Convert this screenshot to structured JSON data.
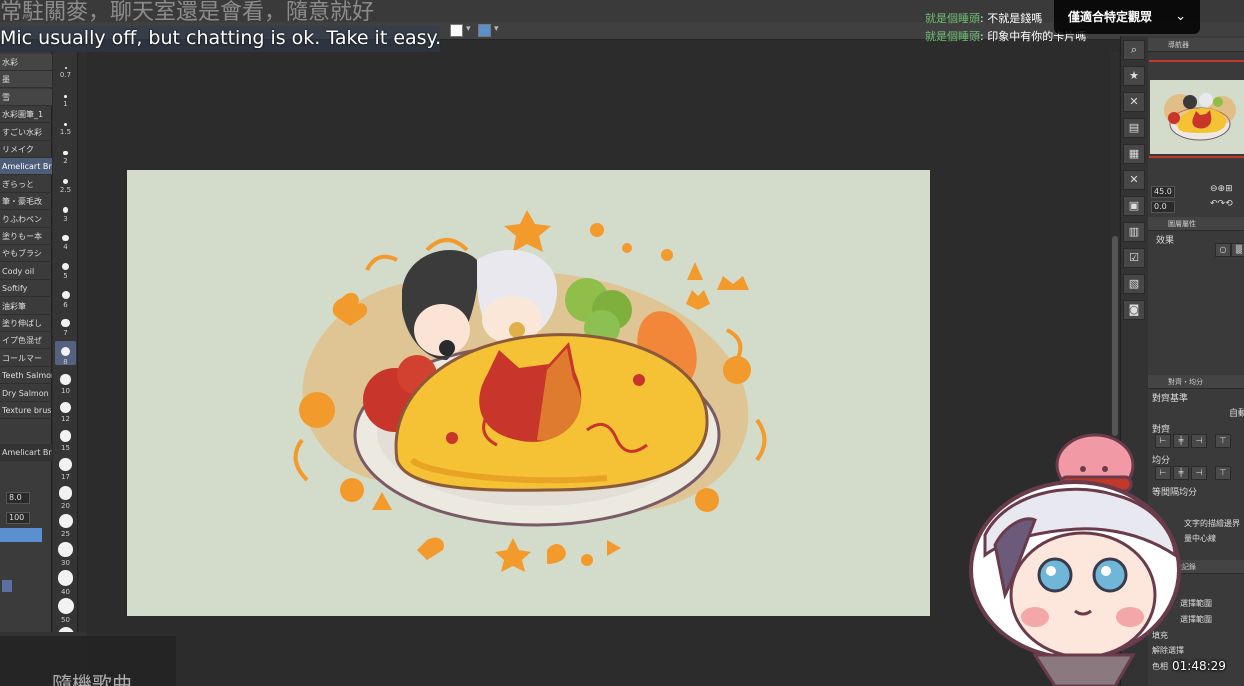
{
  "overlay": {
    "caption_top": "常駐關麥，聊天室還是會看，隨意就好",
    "caption_bottom": "Mic usually off, but chatting is ok. Take it easy.",
    "chat": [
      {
        "name": "就是個睡頭",
        "message": "不就是錢嗎"
      },
      {
        "name": "就是個睡頭",
        "message": "印象中有你的卡片嗎"
      }
    ],
    "select_button": "僅適合特定觀眾",
    "timer": "01:48:29",
    "lyric": "隨機歌曲"
  },
  "brushes": [
    {
      "label": "水彩",
      "selected": false,
      "kind": "btn"
    },
    {
      "label": "墨",
      "selected": false,
      "kind": "btn"
    },
    {
      "label": "雪",
      "selected": false,
      "kind": "btn"
    },
    {
      "label": "水彩圖筆_1",
      "selected": false,
      "kind": "item"
    },
    {
      "label": "すごい水彩",
      "selected": false,
      "kind": "item"
    },
    {
      "label": "リメイク",
      "selected": false,
      "kind": "item"
    },
    {
      "label": "Amelicart Brush",
      "selected": true,
      "kind": "item"
    },
    {
      "label": "ぎらっと",
      "selected": false,
      "kind": "item"
    },
    {
      "label": "筆・豪毛改",
      "selected": false,
      "kind": "item"
    },
    {
      "label": "りふわペン",
      "selected": false,
      "kind": "item"
    },
    {
      "label": "塗りもー本",
      "selected": false,
      "kind": "item"
    },
    {
      "label": "やもブラシ",
      "selected": false,
      "kind": "item"
    },
    {
      "label": "Cody oil",
      "selected": false,
      "kind": "item"
    },
    {
      "label": "Softify",
      "selected": false,
      "kind": "item"
    },
    {
      "label": "油彩筆",
      "selected": false,
      "kind": "item"
    },
    {
      "label": "塗り伸ばし",
      "selected": false,
      "kind": "item"
    },
    {
      "label": "イプ色混ぜ",
      "selected": false,
      "kind": "item"
    },
    {
      "label": "コールマー",
      "selected": false,
      "kind": "item"
    },
    {
      "label": "Teeth Salmon",
      "selected": false,
      "kind": "item"
    },
    {
      "label": "Dry Salmon",
      "selected": false,
      "kind": "item"
    },
    {
      "label": "Texture brush",
      "selected": false,
      "kind": "item"
    }
  ],
  "tool_property": {
    "brush_name": "Amelicart Brush",
    "size_value": "8.0",
    "opacity_value": "100"
  },
  "brush_sizes": [
    {
      "label": "0.7"
    },
    {
      "label": "1"
    },
    {
      "label": "1.5"
    },
    {
      "label": "2"
    },
    {
      "label": "2.5"
    },
    {
      "label": "3"
    },
    {
      "label": "4"
    },
    {
      "label": "5"
    },
    {
      "label": "6"
    },
    {
      "label": "7"
    },
    {
      "label": "8"
    },
    {
      "label": "10"
    },
    {
      "label": "12"
    },
    {
      "label": "15"
    },
    {
      "label": "17"
    },
    {
      "label": "20"
    },
    {
      "label": "25"
    },
    {
      "label": "30"
    },
    {
      "label": "40"
    },
    {
      "label": "50"
    },
    {
      "label": "60"
    }
  ],
  "right_panel": {
    "navigator_title": "導航器",
    "zoom_value": "45.0",
    "rotate_value": "0.0",
    "layer_property_title": "圖層屬性",
    "effect_label": "效果",
    "align_title": "對齊・均分",
    "align_basis": "對齊基準",
    "auto_label": "自動",
    "align_label": "對齊",
    "distribute_label": "均分",
    "spacing_label": "等間隔均分",
    "text_outline": "文字的描繪邊界",
    "center_line": "量中心線",
    "history_title": "歷史記錄",
    "select_range_1": "選擇範圍",
    "select_range_2": "選擇範圍",
    "fill_label": "填充",
    "deselect_label": "解除選擇",
    "color_label": "色相"
  },
  "colors": {
    "accent_orange": "#f7941d",
    "canvas_bg": "#d3dbca",
    "selected_brush": "#4e5d7a",
    "chat_name": "#6fbf73",
    "primary_swatch": "#ffffff",
    "secondary_swatch": "#5b8fc7"
  }
}
